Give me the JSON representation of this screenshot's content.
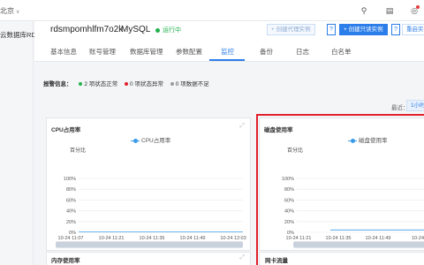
{
  "topbar": {
    "region": "北京",
    "region_chevron": "∨",
    "icons": [
      "search-icon",
      "document-icon",
      "bell-icon"
    ],
    "glyphs": {
      "search": "⚲",
      "doc": "▤",
      "bell": "◎"
    }
  },
  "leftnav": {
    "item": "云数据库RDS"
  },
  "header": {
    "instance_id": "rdsmpomhlfm7o2k",
    "engine": "MySQL",
    "status": "运行中",
    "status_color": "#22b14c",
    "btn_proxy": "+ 创建代理实例",
    "help": "?",
    "btn_readonly": "+ 创建只读实例",
    "btn_restart": "重启实例"
  },
  "tabs": [
    "基本信息",
    "账号管理",
    "数据库管理",
    "参数配置",
    "监控",
    "备份",
    "日志",
    "白名单"
  ],
  "active_tab": "监控",
  "alarm": {
    "label": "报警信息：",
    "items": [
      {
        "text": "2 项状态正常",
        "color": "#22b14c"
      },
      {
        "text": "0 项状态异常",
        "color": "#e0202c"
      },
      {
        "text": "0 项数据不足",
        "color": "#999999"
      }
    ]
  },
  "period": {
    "label": "最近：",
    "value": "1小时"
  },
  "accent_color": "#2b7de9",
  "chart_data": [
    {
      "type": "line",
      "title": "CPU占用率",
      "legend": "CPU占用率",
      "ylabel": "百分比",
      "yticks": [
        "100%",
        "80%",
        "60%",
        "40%",
        "20%",
        "0%"
      ],
      "ylim": [
        0,
        100
      ],
      "xticks": [
        "10-24 11:07",
        "10-24 11:21",
        "10-24 11:35",
        "10-24 11:49",
        "10-24 12:03"
      ],
      "series": [
        {
          "name": "CPU占用率",
          "values": [
            0.6,
            0.6,
            0.6,
            0.7,
            0.6,
            0.6,
            0.7,
            0.6,
            0.6,
            0.7,
            0.6,
            0.6
          ]
        }
      ]
    },
    {
      "type": "line",
      "title": "磁盘使用率",
      "legend": "磁盘使用率",
      "ylabel": "百分比",
      "yticks": [
        "100%",
        "80%",
        "60%",
        "40%",
        "20%",
        "0%"
      ],
      "ylim": [
        0,
        100
      ],
      "xticks": [
        "10-24 11:21",
        "10-24 11:35",
        "10-24 11:49",
        "10-24"
      ],
      "series": [
        {
          "name": "磁盘使用率",
          "values": [
            4.5,
            4.5,
            4.5,
            4.5,
            4.5,
            4.5,
            4.5,
            4.5
          ]
        }
      ]
    }
  ],
  "lower": {
    "left_title": "内存使用率",
    "right_title": "网卡流量"
  }
}
